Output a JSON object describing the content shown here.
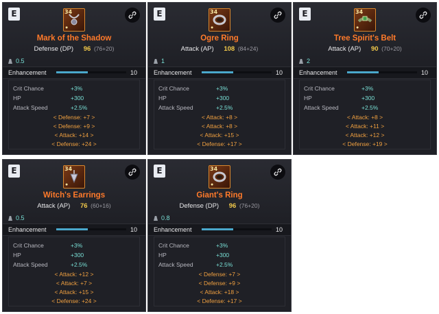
{
  "enhancement_label": "Enhancement",
  "cards": [
    {
      "grade": "E",
      "level": "34",
      "name": "Mark of the Shadow",
      "stat_label": "Defense (DP)",
      "stat_value": "96",
      "stat_detail": "(76+20)",
      "weight": "0.5",
      "enh_value": "10",
      "enh_fraction": 0.45,
      "subs": [
        {
          "k": "Crit Chance",
          "v": "+3%"
        },
        {
          "k": "HP",
          "v": "+300"
        },
        {
          "k": "Attack Speed",
          "v": "+2.5%"
        }
      ],
      "gems": [
        "< Defense: +7 >",
        "< Defense: +9 >",
        "< Attack: +14 >",
        "< Defense: +24 >"
      ],
      "icon": "necklace-icon"
    },
    {
      "grade": "E",
      "level": "34",
      "name": "Ogre Ring",
      "stat_label": "Attack (AP)",
      "stat_value": "108",
      "stat_detail": "(84+24)",
      "weight": "1",
      "enh_value": "10",
      "enh_fraction": 0.45,
      "subs": [
        {
          "k": "Crit Chance",
          "v": "+3%"
        },
        {
          "k": "HP",
          "v": "+300"
        },
        {
          "k": "Attack Speed",
          "v": "+2.5%"
        }
      ],
      "gems": [
        "< Attack: +8 >",
        "< Attack: +8 >",
        "< Attack: +15 >",
        "< Defense: +17 >"
      ],
      "icon": "ring-icon"
    },
    {
      "grade": "E",
      "level": "34",
      "name": "Tree Spirit's Belt",
      "stat_label": "Attack (AP)",
      "stat_value": "90",
      "stat_detail": "(70+20)",
      "weight": "2",
      "enh_value": "10",
      "enh_fraction": 0.45,
      "subs": [
        {
          "k": "Crit Chance",
          "v": "+3%"
        },
        {
          "k": "HP",
          "v": "+300"
        },
        {
          "k": "Attack Speed",
          "v": "+2.5%"
        }
      ],
      "gems": [
        "< Attack: +8 >",
        "< Attack: +11 >",
        "< Attack: +12 >",
        "< Defense: +19 >"
      ],
      "icon": "belt-icon"
    },
    {
      "grade": "E",
      "level": "34",
      "name": "Witch's Earrings",
      "stat_label": "Attack (AP)",
      "stat_value": "76",
      "stat_detail": "(60+16)",
      "weight": "0.5",
      "enh_value": "10",
      "enh_fraction": 0.45,
      "subs": [
        {
          "k": "Crit Chance",
          "v": "+3%"
        },
        {
          "k": "HP",
          "v": "+300"
        },
        {
          "k": "Attack Speed",
          "v": "+2.5%"
        }
      ],
      "gems": [
        "< Attack: +12 >",
        "< Attack: +7 >",
        "< Attack: +15 >",
        "< Defense: +24 >"
      ],
      "icon": "earring-icon"
    },
    {
      "grade": "E",
      "level": "34",
      "name": "Giant's Ring",
      "stat_label": "Defense (DP)",
      "stat_value": "96",
      "stat_detail": "(76+20)",
      "weight": "0.8",
      "enh_value": "10",
      "enh_fraction": 0.45,
      "subs": [
        {
          "k": "Crit Chance",
          "v": "+3%"
        },
        {
          "k": "HP",
          "v": "+300"
        },
        {
          "k": "Attack Speed",
          "v": "+2.5%"
        }
      ],
      "gems": [
        "< Defense: +7 >",
        "< Defense: +9 >",
        "< Attack: +18 >",
        "< Defense: +17 >"
      ],
      "icon": "ring-icon"
    }
  ]
}
